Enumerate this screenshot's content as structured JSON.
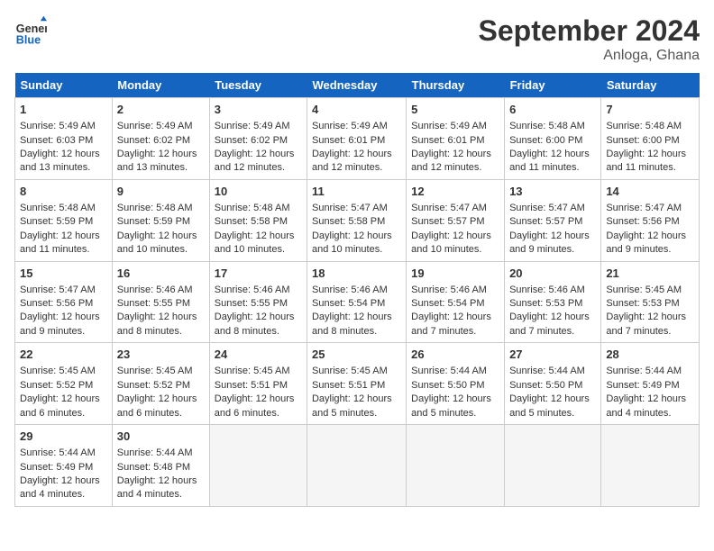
{
  "header": {
    "logo_line1": "General",
    "logo_line2": "Blue",
    "month": "September 2024",
    "location": "Anloga, Ghana"
  },
  "days_of_week": [
    "Sunday",
    "Monday",
    "Tuesday",
    "Wednesday",
    "Thursday",
    "Friday",
    "Saturday"
  ],
  "weeks": [
    [
      {
        "day": "1",
        "sunrise": "5:49 AM",
        "sunset": "6:03 PM",
        "daylight": "12 hours and 13 minutes."
      },
      {
        "day": "2",
        "sunrise": "5:49 AM",
        "sunset": "6:02 PM",
        "daylight": "12 hours and 13 minutes."
      },
      {
        "day": "3",
        "sunrise": "5:49 AM",
        "sunset": "6:02 PM",
        "daylight": "12 hours and 12 minutes."
      },
      {
        "day": "4",
        "sunrise": "5:49 AM",
        "sunset": "6:01 PM",
        "daylight": "12 hours and 12 minutes."
      },
      {
        "day": "5",
        "sunrise": "5:49 AM",
        "sunset": "6:01 PM",
        "daylight": "12 hours and 12 minutes."
      },
      {
        "day": "6",
        "sunrise": "5:48 AM",
        "sunset": "6:00 PM",
        "daylight": "12 hours and 11 minutes."
      },
      {
        "day": "7",
        "sunrise": "5:48 AM",
        "sunset": "6:00 PM",
        "daylight": "12 hours and 11 minutes."
      }
    ],
    [
      {
        "day": "8",
        "sunrise": "5:48 AM",
        "sunset": "5:59 PM",
        "daylight": "12 hours and 11 minutes."
      },
      {
        "day": "9",
        "sunrise": "5:48 AM",
        "sunset": "5:59 PM",
        "daylight": "12 hours and 10 minutes."
      },
      {
        "day": "10",
        "sunrise": "5:48 AM",
        "sunset": "5:58 PM",
        "daylight": "12 hours and 10 minutes."
      },
      {
        "day": "11",
        "sunrise": "5:47 AM",
        "sunset": "5:58 PM",
        "daylight": "12 hours and 10 minutes."
      },
      {
        "day": "12",
        "sunrise": "5:47 AM",
        "sunset": "5:57 PM",
        "daylight": "12 hours and 10 minutes."
      },
      {
        "day": "13",
        "sunrise": "5:47 AM",
        "sunset": "5:57 PM",
        "daylight": "12 hours and 9 minutes."
      },
      {
        "day": "14",
        "sunrise": "5:47 AM",
        "sunset": "5:56 PM",
        "daylight": "12 hours and 9 minutes."
      }
    ],
    [
      {
        "day": "15",
        "sunrise": "5:47 AM",
        "sunset": "5:56 PM",
        "daylight": "12 hours and 9 minutes."
      },
      {
        "day": "16",
        "sunrise": "5:46 AM",
        "sunset": "5:55 PM",
        "daylight": "12 hours and 8 minutes."
      },
      {
        "day": "17",
        "sunrise": "5:46 AM",
        "sunset": "5:55 PM",
        "daylight": "12 hours and 8 minutes."
      },
      {
        "day": "18",
        "sunrise": "5:46 AM",
        "sunset": "5:54 PM",
        "daylight": "12 hours and 8 minutes."
      },
      {
        "day": "19",
        "sunrise": "5:46 AM",
        "sunset": "5:54 PM",
        "daylight": "12 hours and 7 minutes."
      },
      {
        "day": "20",
        "sunrise": "5:46 AM",
        "sunset": "5:53 PM",
        "daylight": "12 hours and 7 minutes."
      },
      {
        "day": "21",
        "sunrise": "5:45 AM",
        "sunset": "5:53 PM",
        "daylight": "12 hours and 7 minutes."
      }
    ],
    [
      {
        "day": "22",
        "sunrise": "5:45 AM",
        "sunset": "5:52 PM",
        "daylight": "12 hours and 6 minutes."
      },
      {
        "day": "23",
        "sunrise": "5:45 AM",
        "sunset": "5:52 PM",
        "daylight": "12 hours and 6 minutes."
      },
      {
        "day": "24",
        "sunrise": "5:45 AM",
        "sunset": "5:51 PM",
        "daylight": "12 hours and 6 minutes."
      },
      {
        "day": "25",
        "sunrise": "5:45 AM",
        "sunset": "5:51 PM",
        "daylight": "12 hours and 5 minutes."
      },
      {
        "day": "26",
        "sunrise": "5:44 AM",
        "sunset": "5:50 PM",
        "daylight": "12 hours and 5 minutes."
      },
      {
        "day": "27",
        "sunrise": "5:44 AM",
        "sunset": "5:50 PM",
        "daylight": "12 hours and 5 minutes."
      },
      {
        "day": "28",
        "sunrise": "5:44 AM",
        "sunset": "5:49 PM",
        "daylight": "12 hours and 4 minutes."
      }
    ],
    [
      {
        "day": "29",
        "sunrise": "5:44 AM",
        "sunset": "5:49 PM",
        "daylight": "12 hours and 4 minutes."
      },
      {
        "day": "30",
        "sunrise": "5:44 AM",
        "sunset": "5:48 PM",
        "daylight": "12 hours and 4 minutes."
      },
      null,
      null,
      null,
      null,
      null
    ]
  ]
}
